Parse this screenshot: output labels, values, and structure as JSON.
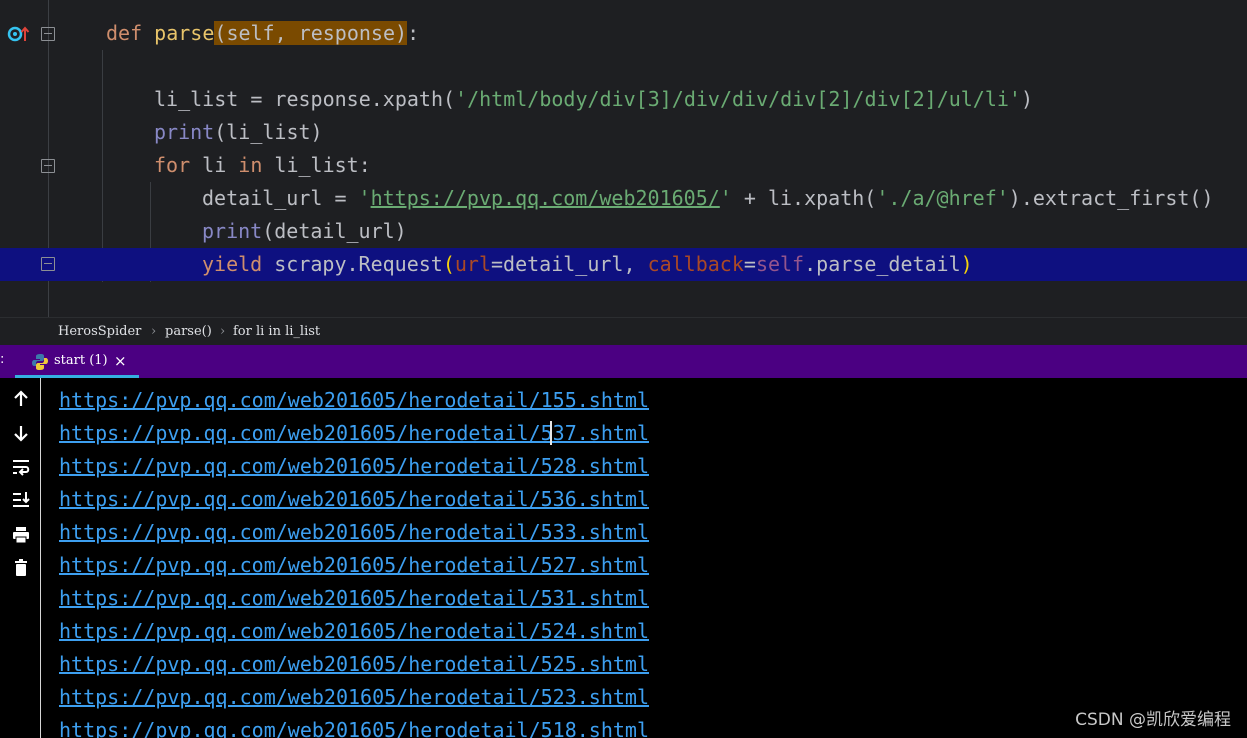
{
  "editor": {
    "lines": [
      {
        "def": "def",
        "name": "parse",
        "params_open": "(",
        "params": "self, response",
        "params_close": ")",
        "colon": ":"
      },
      {
        "var": "li_list",
        "eq": " = ",
        "call": "response.xpath(",
        "arg": "'/html/body/div[3]/div/div/div[2]/div[2]/ul/li'",
        "close": ")"
      },
      {
        "fn": "print",
        "rest": "(li_list)"
      },
      {
        "kw_for": "for",
        "var": " li ",
        "kw_in": "in",
        "rest": " li_list:"
      },
      {
        "var": "detail_url",
        "eq": " = ",
        "q1": "'",
        "url": "https://pvp.qq.com/web201605/",
        "q2": "'",
        "plus": " + li.xpath(",
        "arg": "'./a/@href'",
        "rest": ").extract_first()"
      },
      {
        "fn": "print",
        "rest": "(detail_url)"
      },
      {
        "kw": "yield",
        "call": " scrapy.Request",
        "open": "(",
        "p1": "url",
        "v1": "=detail_url, ",
        "p2": "callback",
        "eq2": "=",
        "self": "self",
        "v2": ".parse_detail",
        "close": ")"
      }
    ]
  },
  "breadcrumb": [
    "HerosSpider",
    "parse()",
    "for li in li_list"
  ],
  "breadcrumb_sep": "›",
  "run": {
    "colon": ":",
    "tab_label": "start (1)",
    "close": "×"
  },
  "toolbar": {
    "up_icon": "arrow-up-icon",
    "down_icon": "arrow-down-icon",
    "wrap_icon": "soft-wrap-icon",
    "scroll_end_icon": "scroll-to-end-icon",
    "print_icon": "print-icon",
    "clear_icon": "trash-icon"
  },
  "console": {
    "lines": [
      "https://pvp.qq.com/web201605/herodetail/155.shtml",
      "https://pvp.qq.com/web201605/herodetail/537.shtml",
      "https://pvp.qq.com/web201605/herodetail/528.shtml",
      "https://pvp.qq.com/web201605/herodetail/536.shtml",
      "https://pvp.qq.com/web201605/herodetail/533.shtml",
      "https://pvp.qq.com/web201605/herodetail/527.shtml",
      "https://pvp.qq.com/web201605/herodetail/531.shtml",
      "https://pvp.qq.com/web201605/herodetail/524.shtml",
      "https://pvp.qq.com/web201605/herodetail/525.shtml",
      "https://pvp.qq.com/web201605/herodetail/523.shtml",
      "https://pvp.qq.com/web201605/herodetail/518.shtml"
    ]
  },
  "watermark": "CSDN @凯欣爱编程",
  "colors": {
    "highlight_line": "#0e1080",
    "run_bar": "#4b0082",
    "link": "#3d9ff0",
    "tab_underline": "#35b0e0"
  }
}
